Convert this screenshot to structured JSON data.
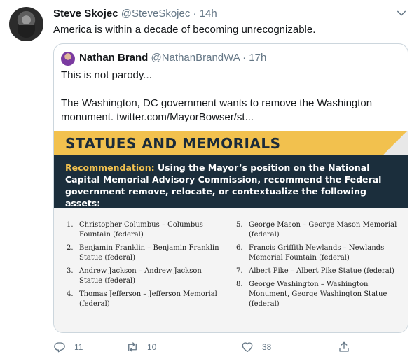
{
  "tweet": {
    "author_name": "Steve Skojec",
    "author_handle": "@SteveSkojec",
    "separator": "·",
    "time": "14h",
    "text": "America is within a decade of becoming unrecognizable."
  },
  "quoted_tweet": {
    "author_name": "Nathan Brand",
    "author_handle": "@NathanBrandWA",
    "separator": "·",
    "time": "17h",
    "text_line1": "This is not parody...",
    "text_line2": "The Washington, DC government wants to remove the Washington monument.",
    "link": "twitter.com/MayorBowser/st..."
  },
  "media": {
    "title": "STATUES AND MEMORIALS",
    "rec_label": "Recommendation:",
    "rec_text": "Using the Mayor’s position on the National Capital Memorial Advisory Commission, recommend the Federal government remove, relocate, or contextualize the following assets:",
    "left_items": [
      {
        "num": "1.",
        "text": "Christopher Columbus – Columbus Fountain (federal)"
      },
      {
        "num": "2.",
        "text": "Benjamin Franklin – Benjamin Franklin Statue (federal)"
      },
      {
        "num": "3.",
        "text": "Andrew Jackson – Andrew Jackson Statue (federal)"
      },
      {
        "num": "4.",
        "text": "Thomas Jefferson – Jefferson Memorial (federal)"
      }
    ],
    "right_items": [
      {
        "num": "5.",
        "text": "George Mason – George Mason Memorial (federal)"
      },
      {
        "num": "6.",
        "text": "Francis Griffith Newlands – Newlands Memorial Fountain (federal)"
      },
      {
        "num": "7.",
        "text": "Albert Pike – Albert Pike Statue (federal)"
      },
      {
        "num": "8.",
        "text": "George Washington – Washington Monument, George Washington Statue (federal)"
      }
    ]
  },
  "actions": {
    "reply_count": "11",
    "retweet_count": "10",
    "like_count": "38"
  },
  "colors": {
    "banner_yellow": "#f2c14e",
    "banner_navy": "#1b2e3c",
    "muted": "#657786"
  },
  "icons": [
    "reply-icon",
    "retweet-icon",
    "like-icon",
    "share-icon",
    "chevron-down-icon"
  ]
}
